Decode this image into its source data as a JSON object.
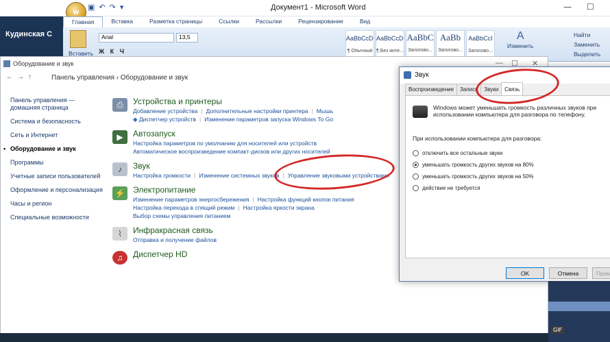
{
  "word": {
    "title": "Документ1 - Microsoft Word",
    "desktop_user": "Кудинская С",
    "tabs": [
      "Главная",
      "Вставка",
      "Разметка страницы",
      "Ссылки",
      "Рассылки",
      "Рецензирование",
      "Вид"
    ],
    "paste_label": "Вставить",
    "font_name": "Arial",
    "font_size": "13,5",
    "styles": [
      {
        "sample": "AaBbCcDc",
        "name": "¶ Обычный"
      },
      {
        "sample": "AaBbCcDc",
        "name": "¶ Без инте..."
      },
      {
        "sample": "AaBbC",
        "name": "Заголово..."
      },
      {
        "sample": "AaBb",
        "name": "Заголово..."
      },
      {
        "sample": "AaBbCcI",
        "name": "Заголово..."
      }
    ],
    "change_styles": "Изменить",
    "find": "Найти",
    "replace": "Заменить",
    "select": "Выделить"
  },
  "control_panel": {
    "window_title": "Оборудование и звук",
    "breadcrumb": "Панель управления  ›  Оборудование и звук",
    "nav": [
      "Панель управления — домашняя страница",
      "Система и безопасность",
      "Сеть и Интернет",
      "Оборудование и звук",
      "Программы",
      "Учетные записи пользователей",
      "Оформление и персонализация",
      "Часы и регион",
      "Специальные возможности"
    ],
    "categories": [
      {
        "heading": "Устройства и принтеры",
        "icon": "printer-icon",
        "lines": [
          [
            "Добавление устройства",
            "Дополнительные настройки принтера",
            "Мышь"
          ],
          [
            "Диспетчер устройств",
            "Изменение параметров запуска Windows To Go"
          ]
        ]
      },
      {
        "heading": "Автозапуск",
        "icon": "autoplay-icon",
        "lines": [
          [
            "Настройка параметров по умолчанию для носителей или устройств"
          ],
          [
            "Автоматическое воспроизведение компакт-дисков или других носителей"
          ]
        ]
      },
      {
        "heading": "Звук",
        "icon": "speaker-icon",
        "lines": [
          [
            "Настройка громкости",
            "Изменение системных звуков",
            "Управление звуковыми устройствами"
          ]
        ]
      },
      {
        "heading": "Электропитание",
        "icon": "power-icon",
        "lines": [
          [
            "Изменение параметров энергосбережения",
            "Настройка функций кнопок питания"
          ],
          [
            "Настройка перехода в спящий режим",
            "Настройка яркости экрана"
          ],
          [
            "Выбор схемы управления питанием"
          ]
        ]
      },
      {
        "heading": "Инфракрасная связь",
        "icon": "infrared-icon",
        "lines": [
          [
            "Отправка и получение файлов"
          ]
        ]
      },
      {
        "heading": "Диспетчер HD",
        "icon": "hd-manager-icon",
        "lines": []
      }
    ]
  },
  "sound_dialog": {
    "title": "Звук",
    "tabs": [
      "Воспроизведение",
      "Запись",
      "Звуки",
      "Связь"
    ],
    "active_tab": "Связь",
    "info": "Windows может уменьшать громкость различных звуков при использовании компьютера для разговора по телефону.",
    "question": "При использовании компьютера для разговора:",
    "options": [
      {
        "label": "отключить все остальные звуки",
        "selected": false
      },
      {
        "label": "уменьшать громкость других звуков на 80%",
        "selected": true
      },
      {
        "label": "уменьшать громкость других звуков на 50%",
        "selected": false
      },
      {
        "label": "действие не требуется",
        "selected": false
      }
    ],
    "ok": "OK",
    "cancel": "Отмена",
    "apply": "Применить"
  },
  "desktop": {
    "gif_label": "GIF"
  },
  "colors": {
    "link": "#1b4f9a",
    "category_heading": "#1e5a1e",
    "annotation_red": "#d42828"
  }
}
